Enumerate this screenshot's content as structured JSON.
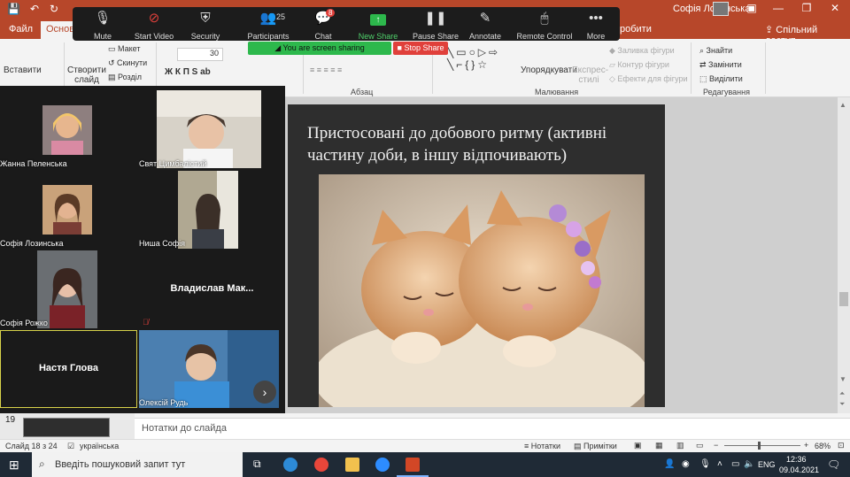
{
  "ppt": {
    "user_name": "Софія Лозинська",
    "tabs": [
      "Файл",
      "Основне",
      "робити"
    ],
    "share_label": "Спільний доступ",
    "ribbon": {
      "insert_slide_btn": "Вставити",
      "create_slide_btn": "Створити слайд",
      "layout": "Макет",
      "reset": "Скинути",
      "section": "Розділ",
      "font_size": "30",
      "font_buttons": "Ж  К  П  S  ab",
      "paragraph_label": "Абзац",
      "arrange": "Упорядкувати",
      "quick_styles": "Експрес-стилі",
      "shape_fill": "Заливка фігури",
      "shape_outline": "Контур фігури",
      "shape_effects": "Ефекти для фігури",
      "drawing_label": "Малювання",
      "find": "Знайти",
      "replace": "Замінити",
      "select": "Виділити",
      "editing_label": "Редагування"
    },
    "slide": {
      "title": "Пристосовані до добового ритму (активні частину доби, в іншу відпочивають)",
      "image_desc": "two-sleeping-kittens"
    },
    "thumbnail_number": "19",
    "notes_placeholder": "Нотатки до слайда",
    "status": {
      "slide_count": "Слайд 18 з 24",
      "language": "українська",
      "notes_btn": "Нотатки",
      "comments_btn": "Примітки",
      "zoom": "68%"
    }
  },
  "zoom": {
    "toolbar": [
      {
        "label": "Mute",
        "icon": "microphone-icon"
      },
      {
        "label": "Start Video",
        "icon": "video-off-icon"
      },
      {
        "label": "Security",
        "icon": "shield-icon"
      },
      {
        "label": "Participants",
        "icon": "participants-icon",
        "count": "25"
      },
      {
        "label": "Chat",
        "icon": "chat-icon",
        "badge": "8"
      },
      {
        "label": "New Share",
        "icon": "new-share-icon"
      },
      {
        "label": "Pause Share",
        "icon": "pause-icon"
      },
      {
        "label": "Annotate",
        "icon": "pen-icon"
      },
      {
        "label": "Remote Control",
        "icon": "mouse-icon"
      },
      {
        "label": "More",
        "icon": "more-icon"
      }
    ],
    "sharing_banner": "You are screen sharing",
    "stop_share": "Stop Share",
    "participants": [
      {
        "name": "Жанна Пеленська",
        "video": true
      },
      {
        "name": "Свят Цимбалістий",
        "video": true
      },
      {
        "name": "Софія Лозинська",
        "video": true
      },
      {
        "name": "Ниша Софія",
        "video": true
      },
      {
        "name": "Софія Рожко",
        "video": true
      },
      {
        "name": "Владислав Мак...",
        "video": false
      },
      {
        "name": "Настя Глова",
        "video": false
      },
      {
        "name": "Олексій Рудь",
        "video": true
      }
    ]
  },
  "taskbar": {
    "search_placeholder": "Введіть пошуковий запит тут",
    "lang": "ENG",
    "time": "12:36",
    "date": "09.04.2021"
  }
}
